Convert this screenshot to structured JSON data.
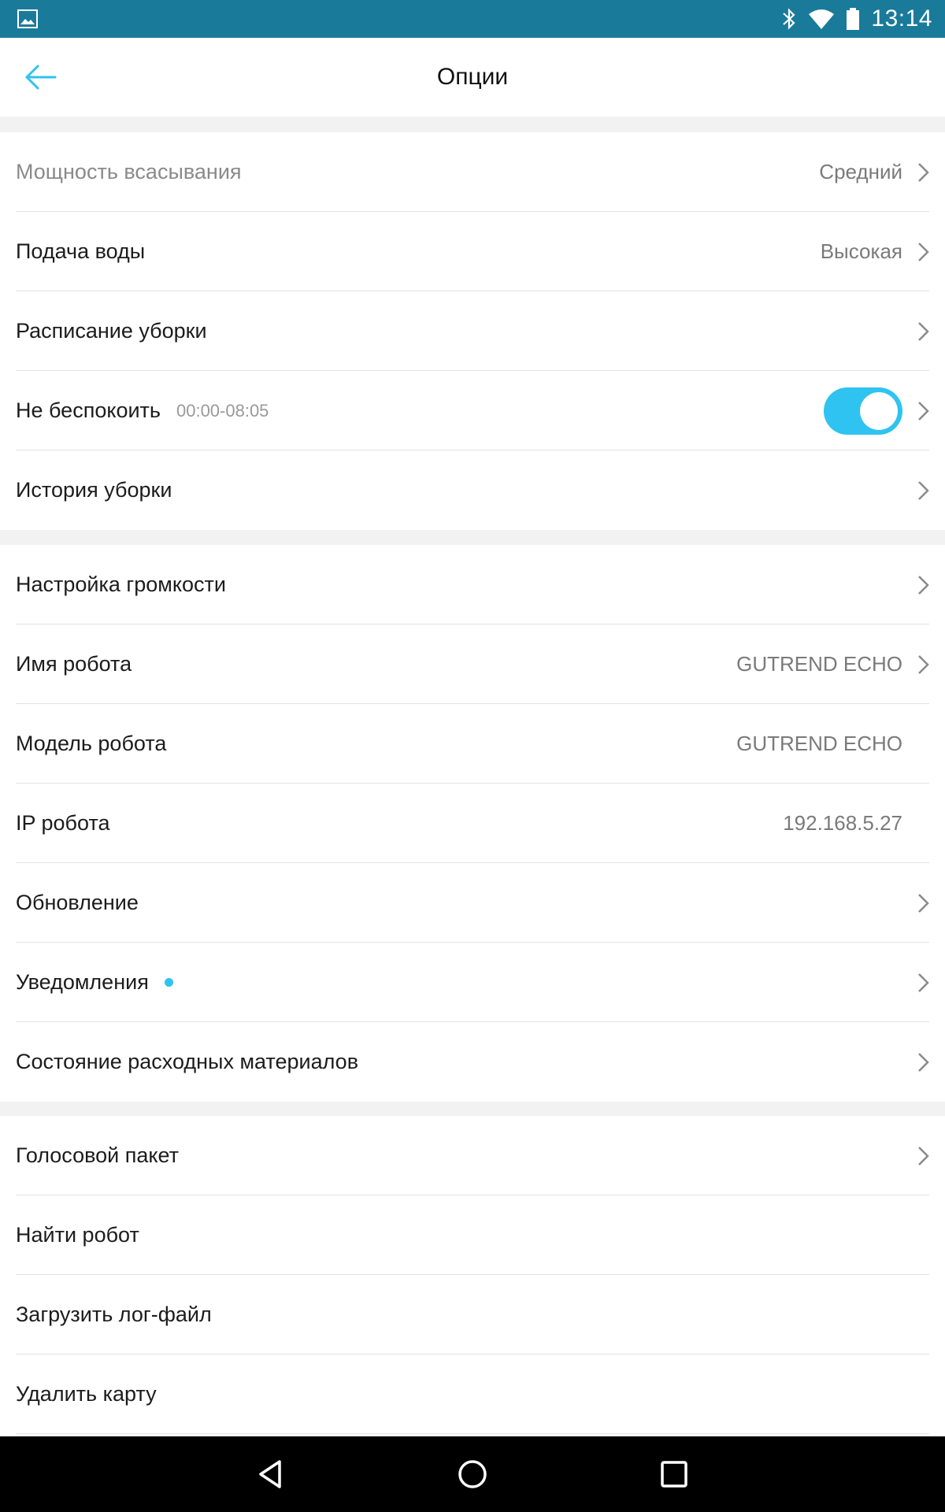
{
  "status_bar": {
    "time": "13:14",
    "icons": [
      "gallery-icon",
      "bluetooth-icon",
      "wifi-icon",
      "battery-icon"
    ]
  },
  "app_bar": {
    "title": "Опции",
    "back_icon": "arrow-left-icon"
  },
  "colors": {
    "accent": "#2ec3f0",
    "status_bar": "#1a7a9a",
    "background": "#f2f2f2"
  },
  "section1": {
    "items": [
      {
        "label": "Мощность всасывания",
        "value": "Средний"
      },
      {
        "label": "Подача воды",
        "value": "Высокая"
      },
      {
        "label": "Расписание уборки"
      },
      {
        "label": "Не беспокоить",
        "sub": "00:00-08:05",
        "toggle": true
      },
      {
        "label": "История уборки"
      }
    ]
  },
  "section2": {
    "items": [
      {
        "label": "Настройка громкости"
      },
      {
        "label": "Имя робота",
        "value": "GUTREND ECHO"
      },
      {
        "label": "Модель робота",
        "value": "GUTREND ECHO"
      },
      {
        "label": "IP робота",
        "value": "192.168.5.27"
      },
      {
        "label": "Обновление"
      },
      {
        "label": "Уведомления"
      },
      {
        "label": "Состояние расходных материалов"
      }
    ]
  },
  "section3": {
    "items": [
      {
        "label": "Голосовой пакет"
      },
      {
        "label": "Найти робот"
      },
      {
        "label": "Загрузить лог-файл"
      },
      {
        "label": "Удалить карту"
      }
    ]
  },
  "nav_bar": {
    "icons": [
      "back-triangle-icon",
      "home-circle-icon",
      "recents-square-icon"
    ]
  }
}
